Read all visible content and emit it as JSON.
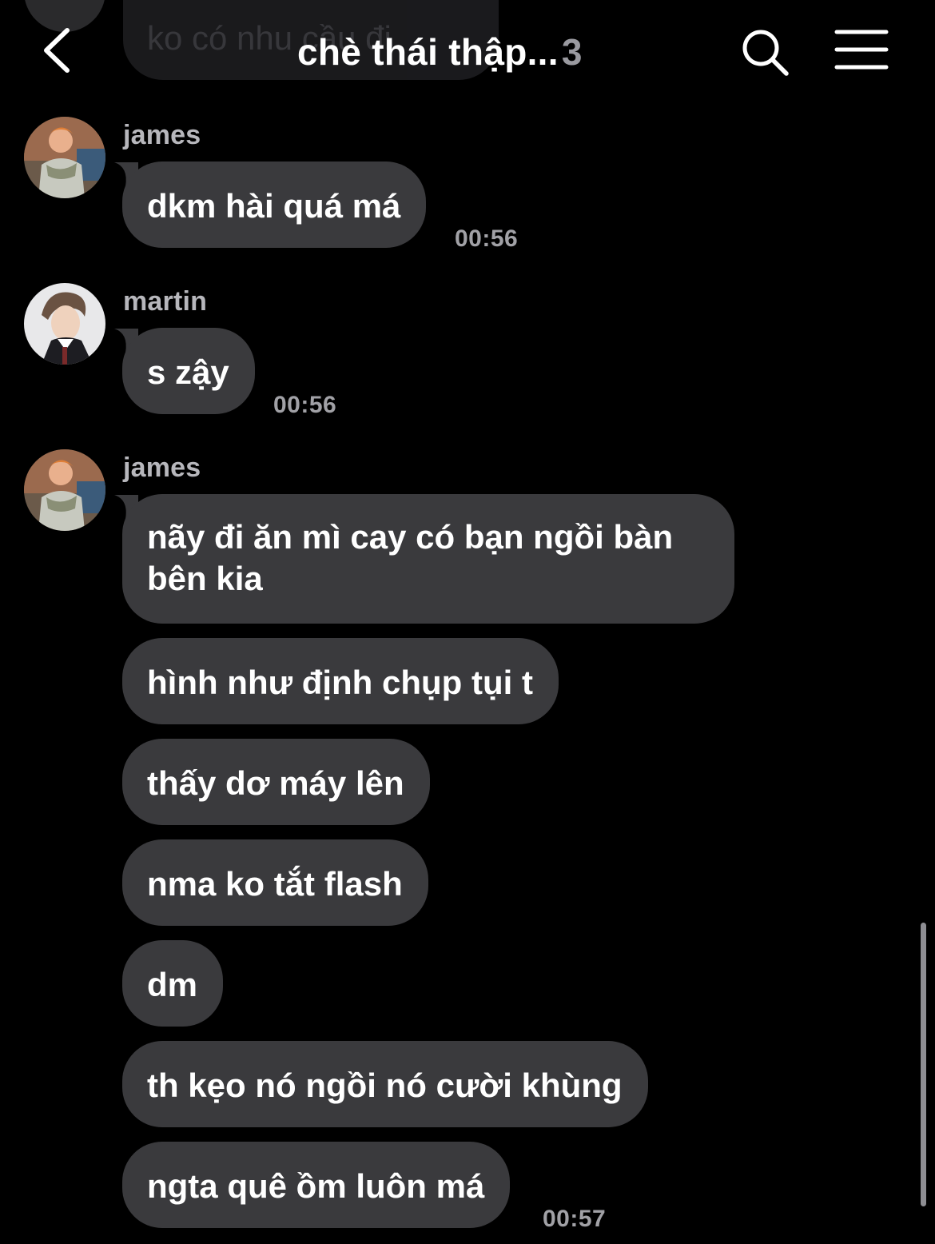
{
  "previous_message": {
    "text": "ko có nhu cầu đi"
  },
  "header": {
    "title": "chè thái thập...",
    "member_count": "3"
  },
  "messages": [
    {
      "sender": "james",
      "bubbles": [
        "dkm hài quá má"
      ],
      "time": "00:56",
      "avatar": "james"
    },
    {
      "sender": "martin",
      "bubbles": [
        "s zậy"
      ],
      "time": "00:56",
      "avatar": "martin"
    },
    {
      "sender": "james",
      "bubbles": [
        "nãy đi ăn mì cay có bạn ngồi bàn bên kia",
        "hình như định chụp tụi t",
        "thấy dơ máy lên",
        "nma ko tắt flash",
        "dm",
        "th kẹo nó ngồi nó cười khùng",
        "ngta quê ồm luôn má"
      ],
      "time": "00:57",
      "avatar": "james"
    }
  ],
  "colors": {
    "background": "#000000",
    "bubble": "#3a3a3d",
    "sender": "#b7b7bc",
    "timestamp": "#a1a1a6"
  },
  "icons": {
    "back": "chevron-left-icon",
    "search": "search-icon",
    "menu": "hamburger-menu-icon"
  }
}
